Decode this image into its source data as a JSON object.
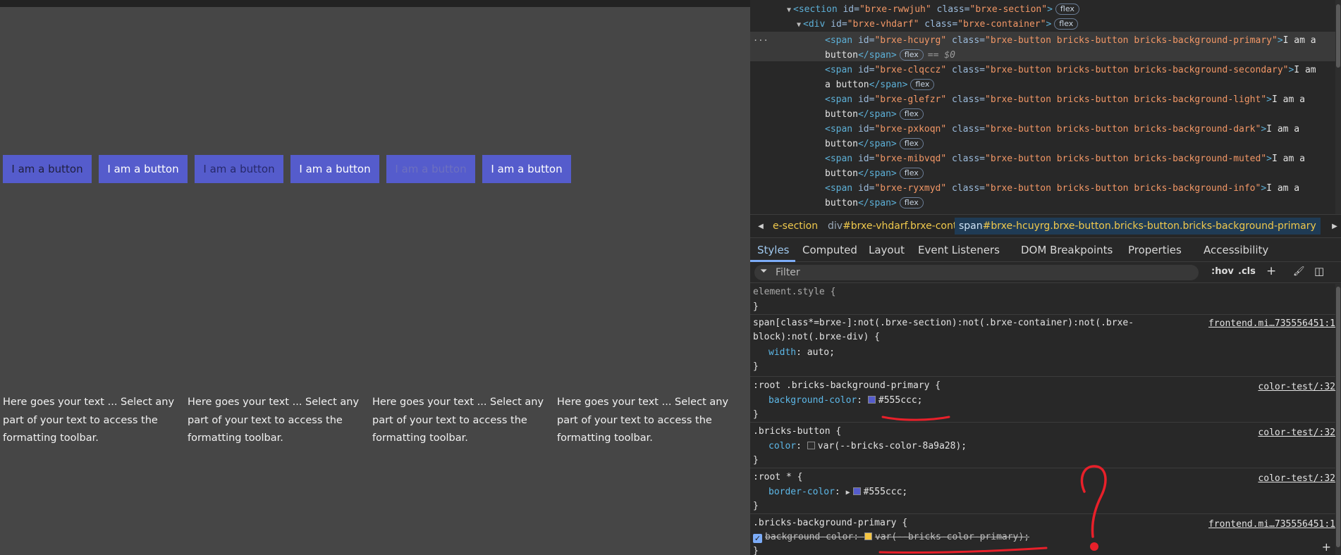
{
  "preview": {
    "buttons": [
      {
        "label": "I am a button",
        "color": "#202040"
      },
      {
        "label": "I am a button",
        "color": "#ffffff"
      },
      {
        "label": "I am a button",
        "color": "#27296a"
      },
      {
        "label": "I am a button",
        "color": "#ffffff"
      },
      {
        "label": "I am a button",
        "color": "#6d70bf"
      },
      {
        "label": "I am a button",
        "color": "#ffffff"
      }
    ],
    "button_bg": "#555ccc",
    "text_blocks": [
      "Here goes your text ... Select any part of your text to access the formatting toolbar.",
      "Here goes your text ... Select any part of your text to access the formatting toolbar.",
      "Here goes your text ... Select any part of your text to access the formatting toolbar.",
      "Here goes your text ... Select any part of your text to access the formatting toolbar."
    ]
  },
  "devtools": {
    "dom": {
      "section_line": {
        "tag_open": "<section",
        "id_attr": " id=",
        "id_val": "\"brxe-rwwjuh\"",
        "class_attr": " class=",
        "class_val": "\"brxe-section\"",
        "tag_close": ">",
        "badge": "flex"
      },
      "div_line": {
        "tag_open": "<div",
        "id_attr": " id=",
        "id_val": "\"brxe-vhdarf\"",
        "class_attr": " class=",
        "class_val": "\"brxe-container\"",
        "tag_close": ">",
        "badge": "flex"
      },
      "spans": [
        {
          "id_val": "\"brxe-hcuyrg\"",
          "class_val": "\"brxe-button bricks-button bricks-background-primary\"",
          "text_a": "I am a",
          "text_b": "button",
          "selected_marker": "== $0"
        },
        {
          "id_val": "\"brxe-clqccz\"",
          "class_val": "\"brxe-button bricks-button bricks-background-secondary\"",
          "text_a": "I am",
          "text_b": "a button"
        },
        {
          "id_val": "\"brxe-glefzr\"",
          "class_val": "\"brxe-button bricks-button bricks-background-light\"",
          "text_a": "I am a",
          "text_b": "button"
        },
        {
          "id_val": "\"brxe-pxkoqn\"",
          "class_val": "\"brxe-button bricks-button bricks-background-dark\"",
          "text_a": "I am a",
          "text_b": "button"
        },
        {
          "id_val": "\"brxe-mibvqd\"",
          "class_val": "\"brxe-button bricks-button bricks-background-muted\"",
          "text_a": "I am a",
          "text_b": "button"
        },
        {
          "id_val": "\"brxe-ryxmyd\"",
          "class_val": "\"brxe-button bricks-button bricks-background-info\"",
          "text_a": "I am a",
          "text_b": "button"
        }
      ],
      "span_tag_open": "<span",
      "span_tag_end": "</span>",
      "id_attr": " id=",
      "class_attr": " class=",
      "gt": ">",
      "badge": "flex",
      "dots": "..."
    },
    "breadcrumbs": [
      {
        "tag": "e-section",
        "cls": ""
      },
      {
        "tag": "div",
        "cls": "#brxe-vhdarf.brxe-container"
      },
      {
        "tag": "span",
        "cls": "#brxe-hcuyrg.brxe-button.bricks-button.bricks-background-primary"
      }
    ],
    "tabs": [
      "Styles",
      "Computed",
      "Layout",
      "Event Listeners",
      "DOM Breakpoints",
      "Properties",
      "Accessibility"
    ],
    "filter": {
      "placeholder": "Filter",
      "hov": ":hov",
      "cls": ".cls",
      "plus": "+",
      "paint": "🖌",
      "sidebar": "◫"
    },
    "rules": {
      "element_style": {
        "selector": "element.style {",
        "close": "}"
      },
      "width_rule": {
        "selector_a": "span[class*=brxe-]:not(.brxe-section):not(.brxe-container):not(.brxe-",
        "selector_b": "block):not(.brxe-div) {",
        "prop": "width",
        "value": "auto;",
        "source": "frontend.mi…735556451:1",
        "close": "}"
      },
      "root_primary": {
        "selector": ":root .bricks-background-primary {",
        "prop": "background-color",
        "swatch": "#555ccc",
        "value": "#555ccc;",
        "source": "color-test/:32",
        "close": "}"
      },
      "bricks_button": {
        "selector": ".bricks-button {",
        "prop": "color",
        "swatch": "#2b2b2b",
        "value": "var(--bricks-color-8a9a28);",
        "source": "color-test/:32",
        "close": "}"
      },
      "root_star": {
        "selector": ":root * {",
        "prop": "border-color",
        "swatch": "#555ccc",
        "value": "#555ccc;",
        "source": "color-test/:32",
        "close": "}"
      },
      "bg_primary": {
        "selector": ".bricks-background-primary {",
        "prop": "background-color",
        "swatch": "#f5c542",
        "value": "var(--bricks-color-primary);",
        "source": "frontend.mi…735556451:1",
        "close": "}"
      }
    },
    "add_rule": "+"
  }
}
